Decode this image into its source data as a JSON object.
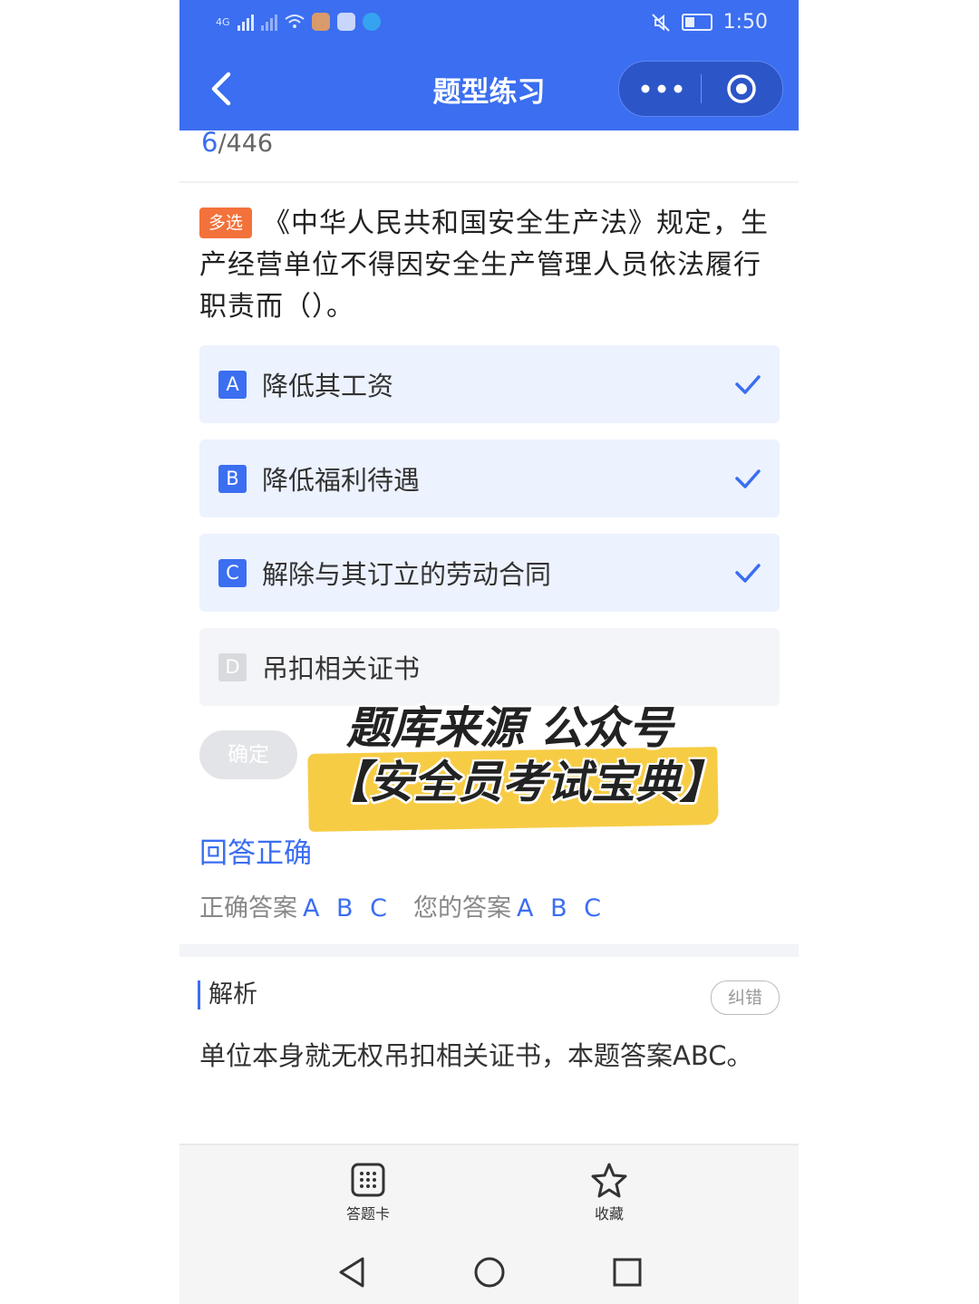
{
  "status_bar": {
    "network": "4G",
    "time": "1:50",
    "colors": {
      "bar": "#3b6ef0"
    }
  },
  "header": {
    "title": "题型练习",
    "back_icon": "chevron-left-icon",
    "menu_icon": "more-dots-icon",
    "close_icon": "target-circle-icon"
  },
  "progress": {
    "current": "6",
    "total": "/446"
  },
  "question": {
    "type_tag": "多选",
    "text": "《中华人民共和国安全生产法》规定，生产经营单位不得因安全生产管理人员依法履行职责而（）。"
  },
  "options": [
    {
      "letter": "A",
      "text": "降低其工资",
      "selected": true
    },
    {
      "letter": "B",
      "text": "降低福利待遇",
      "selected": true
    },
    {
      "letter": "C",
      "text": "解除与其订立的劳动合同",
      "selected": true
    },
    {
      "letter": "D",
      "text": "吊扣相关证书",
      "selected": false
    }
  ],
  "confirm_label": "确定",
  "watermark": {
    "line1": "题库来源 公众号",
    "line2": "【安全员考试宝典】"
  },
  "result": {
    "status": "回答正确",
    "correct_label": "正确答案",
    "correct_value": "A B C",
    "yours_label": "您的答案",
    "yours_value": "A B C"
  },
  "explanation": {
    "title": "解析",
    "report_label": "纠错",
    "text": "单位本身就无权吊扣相关证书，本题答案ABC。"
  },
  "bottom_nav": {
    "answer_card_label": "答题卡",
    "favorite_label": "收藏"
  },
  "colors": {
    "accent": "#3b6ef0",
    "tag": "#f3723b",
    "highlight": "#f7cc45"
  }
}
